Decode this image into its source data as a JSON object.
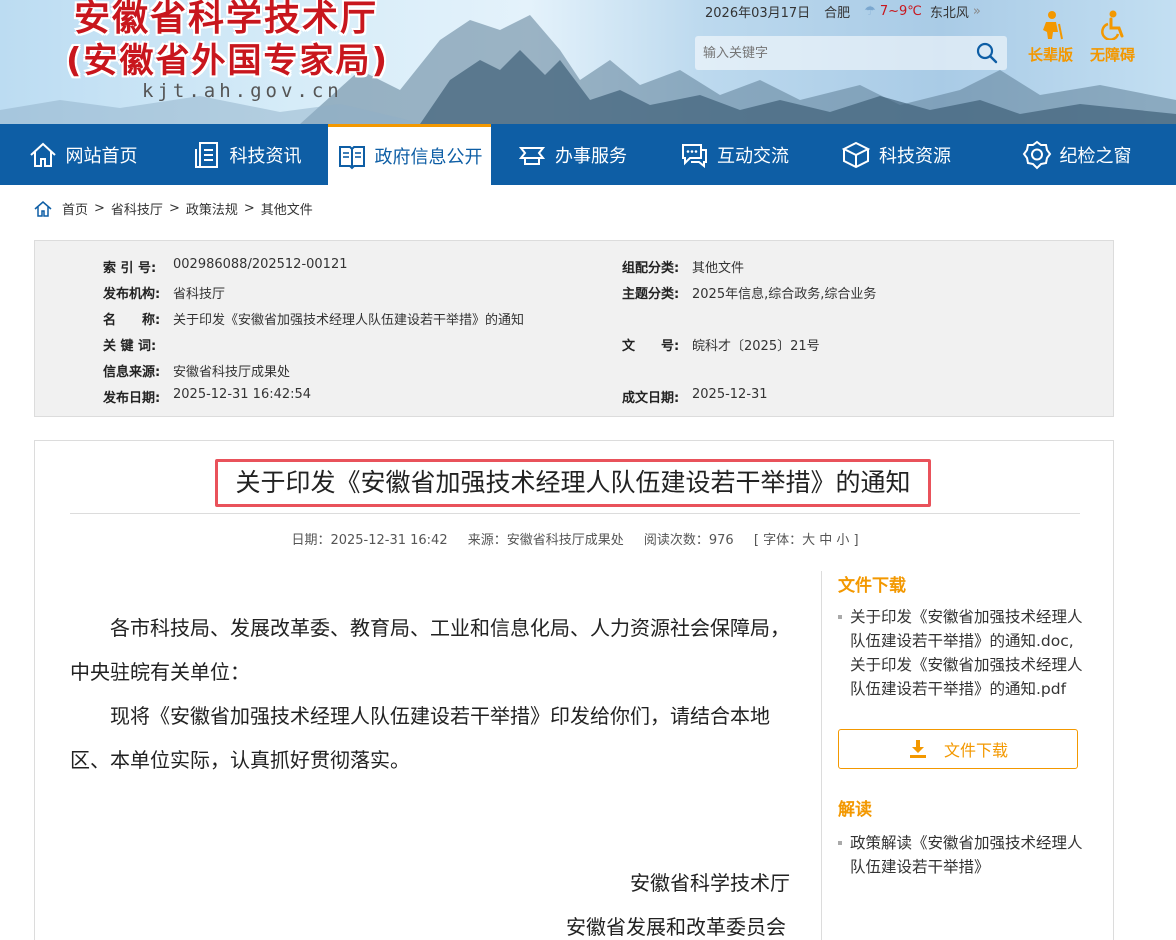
{
  "header": {
    "logo_line1": "安徽省科学技术厅",
    "logo_line2": "(安徽省外国专家局)",
    "domain": "kjt.ah.gov.cn",
    "date": "2026年03月17日",
    "city": "合肥",
    "temperature": "7~9℃",
    "wind": "东北风",
    "search_placeholder": "输入关键字",
    "elder_mode": "长辈版",
    "accessibility": "无障碍"
  },
  "nav": [
    {
      "label": "网站首页",
      "icon": "home-icon"
    },
    {
      "label": "科技资讯",
      "icon": "document-icon"
    },
    {
      "label": "政府信息公开",
      "icon": "book-icon"
    },
    {
      "label": "办事服务",
      "icon": "service-icon"
    },
    {
      "label": "互动交流",
      "icon": "chat-icon"
    },
    {
      "label": "科技资源",
      "icon": "box-icon"
    },
    {
      "label": "纪检之窗",
      "icon": "badge-icon"
    }
  ],
  "breadcrumb": [
    "首页",
    ">",
    "省科技厅",
    ">",
    "政策法规",
    ">",
    "其他文件"
  ],
  "meta": {
    "index_label": "索 引 号:",
    "index": "002986088/202512-00121",
    "category_label": "组配分类:",
    "category": "其他文件",
    "publisher_label": "发布机构:",
    "publisher": "省科技厅",
    "topic_label": "主题分类:",
    "topic": "2025年信息,综合政务,综合业务",
    "name_label": "名　　称:",
    "name": "关于印发《安徽省加强技术经理人队伍建设若干举措》的通知",
    "keyword_label": "关 键 词:",
    "keyword": "",
    "docno_label": "文　　号:",
    "docno": "皖科才〔2025〕21号",
    "source_label": "信息来源:",
    "source": "安徽省科技厅成果处",
    "pubdate_label": "发布日期:",
    "pubdate": "2025-12-31 16:42:54",
    "createdate_label": "成文日期:",
    "createdate": "2025-12-31"
  },
  "article": {
    "title": "关于印发《安徽省加强技术经理人队伍建设若干举措》的通知",
    "date": "日期：2025-12-31 16:42",
    "source": "来源：安徽省科技厅成果处",
    "views": "阅读次数：976",
    "font_label": "[ 字体：大 中 小 ]",
    "para1": "各市科技局、发展改革委、教育局、工业和信息化局、人力资源社会保障局，中央驻皖有关单位：",
    "para2": "现将《安徽省加强技术经理人队伍建设若干举措》印发给你们，请结合本地区、本单位实际，认真抓好贯彻落实。",
    "signer1": "安徽省科学技术厅",
    "signer2": "安徽省发展和改革委员会"
  },
  "sidebar": {
    "files_heading": "文件下载",
    "files_text": "关于印发《安徽省加强技术经理人队伍建设若干举措》的通知.doc,关于印发《安徽省加强技术经理人队伍建设若干举措》的通知.pdf",
    "download_button": "文件下载",
    "interpret_heading": "解读",
    "interpret_text": "政策解读《安徽省加强技术经理人队伍建设若干举措》"
  },
  "colors": {
    "nav_bg": "#0e5ea5",
    "accent": "#f39800",
    "logo_red": "#c8161d",
    "highlight": "#e9525b"
  }
}
